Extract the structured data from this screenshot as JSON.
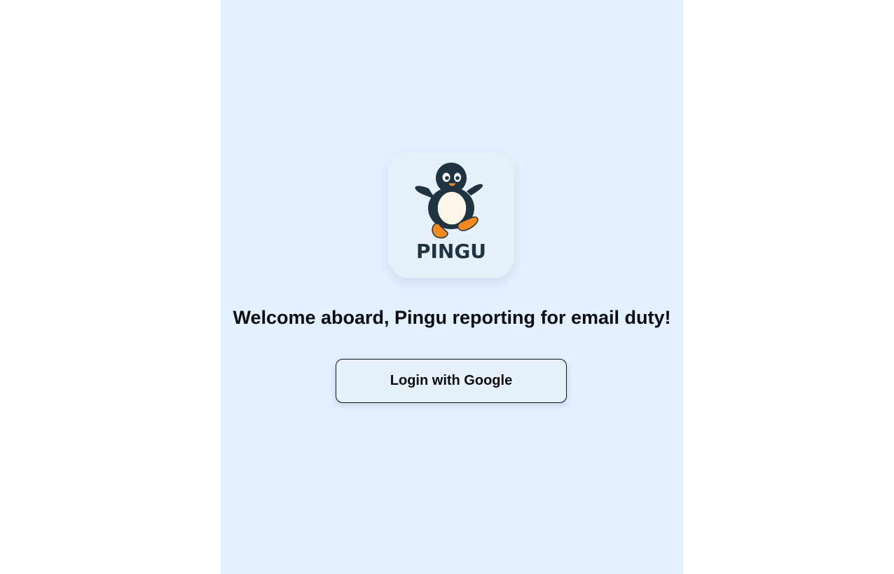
{
  "brand": {
    "logo_text": "PINGU",
    "colors": {
      "panel_background": "#e3f0fd",
      "page_background": "#ffffff",
      "penguin_dark": "#1f3340",
      "penguin_belly": "#fdf7ea",
      "penguin_orange": "#f4891f",
      "text": "#0b0b14"
    }
  },
  "welcome": {
    "headline": "Welcome aboard, Pingu reporting for email duty!"
  },
  "auth": {
    "login_label": "Login with Google"
  }
}
